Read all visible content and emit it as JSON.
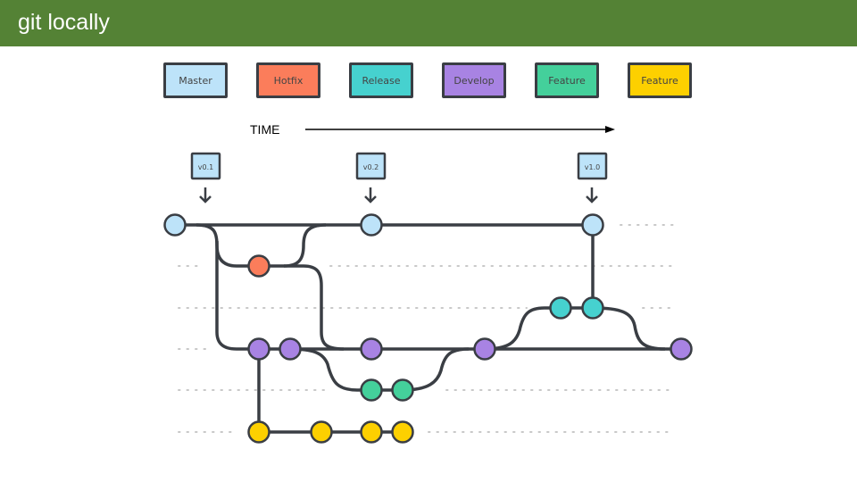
{
  "header": {
    "title": "git locally",
    "background": "#548235"
  },
  "legend": [
    {
      "label": "Master",
      "color": "#bde3f9"
    },
    {
      "label": "Hotfix",
      "color": "#fb7d5b"
    },
    {
      "label": "Release",
      "color": "#46d1cf"
    },
    {
      "label": "Develop",
      "color": "#a883e3"
    },
    {
      "label": "Feature",
      "color": "#44d09b"
    },
    {
      "label": "Feature",
      "color": "#fdd000"
    }
  ],
  "time_label": "TIME",
  "tags": [
    {
      "label": "v0.1",
      "branch": "master"
    },
    {
      "label": "v0.2",
      "branch": "master"
    },
    {
      "label": "v1.0",
      "branch": "master"
    }
  ],
  "branches": [
    {
      "name": "master",
      "color": "#bde3f9",
      "commits": 3
    },
    {
      "name": "hotfix",
      "color": "#fb7d5b",
      "commits": 1
    },
    {
      "name": "release",
      "color": "#46d1cf",
      "commits": 2
    },
    {
      "name": "develop",
      "color": "#a883e3",
      "commits": 5
    },
    {
      "name": "feature-1",
      "color": "#44d09b",
      "commits": 2
    },
    {
      "name": "feature-2",
      "color": "#fdd000",
      "commits": 4
    }
  ],
  "colors": {
    "line": "#3a3e44",
    "dots": "#c8c8c8",
    "arrow": "#000000"
  }
}
